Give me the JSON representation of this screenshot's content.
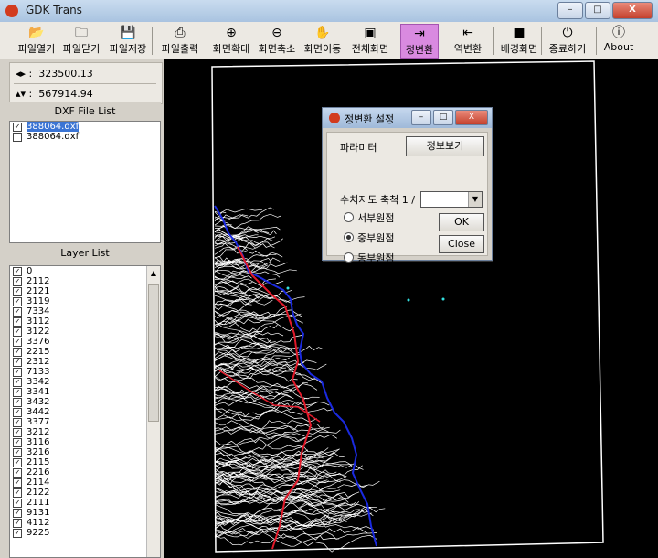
{
  "window": {
    "title": "GDK Trans",
    "minimize": "–",
    "maximize": "□",
    "close": "X"
  },
  "toolbar": [
    {
      "label": "파일열기",
      "icon": "open-file-icon",
      "active": false
    },
    {
      "label": "파일닫기",
      "icon": "close-file-icon",
      "active": false
    },
    {
      "label": "파일저장",
      "icon": "save-icon",
      "active": false
    },
    {
      "label": "파일출력",
      "icon": "print-icon",
      "active": false
    },
    {
      "label": "화면확대",
      "icon": "zoom-in-icon",
      "active": false
    },
    {
      "label": "화면축소",
      "icon": "zoom-out-icon",
      "active": false
    },
    {
      "label": "화면이동",
      "icon": "pan-hand-icon",
      "active": false
    },
    {
      "label": "전체화면",
      "icon": "full-screen-icon",
      "active": false
    },
    {
      "label": "정변환",
      "icon": "forward-transform-icon",
      "active": true
    },
    {
      "label": "역변환",
      "icon": "inverse-transform-icon",
      "active": false
    },
    {
      "label": "배경화면",
      "icon": "background-icon",
      "active": false
    },
    {
      "label": "종료하기",
      "icon": "exit-icon",
      "active": false
    },
    {
      "label": "About",
      "icon": "about-icon",
      "active": false
    }
  ],
  "coords": {
    "x_value": "323500.13",
    "y_value": "567914.94",
    "x_icon": "horizontal-arrows-icon",
    "y_icon": "vertical-arrows-icon"
  },
  "dxf_list": {
    "title": "DXF File List",
    "items": [
      {
        "name": "388064.dxf",
        "checked": true,
        "selected": true
      },
      {
        "name": "388064.dxf",
        "checked": false,
        "selected": false
      }
    ]
  },
  "layer_list": {
    "title": "Layer List",
    "items": [
      "0",
      "2112",
      "2121",
      "3119",
      "7334",
      "3112",
      "3122",
      "3376",
      "2215",
      "2312",
      "7133",
      "3342",
      "3341",
      "3432",
      "3442",
      "3377",
      "3212",
      "3116",
      "3216",
      "2115",
      "2216",
      "2114",
      "2122",
      "2111",
      "9131",
      "4112",
      "9225"
    ]
  },
  "dialog": {
    "title": "정변환 설정",
    "param_label": "파라미터",
    "info_button": "정보보기",
    "scale_label": "수치지도 축척 1 /",
    "scale_value": "",
    "origins": [
      {
        "label": "서부원점",
        "selected": false
      },
      {
        "label": "중부원점",
        "selected": true
      },
      {
        "label": "동부원점",
        "selected": false
      }
    ],
    "ok_button": "OK",
    "close_button": "Close"
  },
  "map": {
    "border_color": "#ffffff",
    "contour_color": "#ffffff",
    "road_color": "#e11a2a",
    "coast_color": "#1a2ae0"
  }
}
